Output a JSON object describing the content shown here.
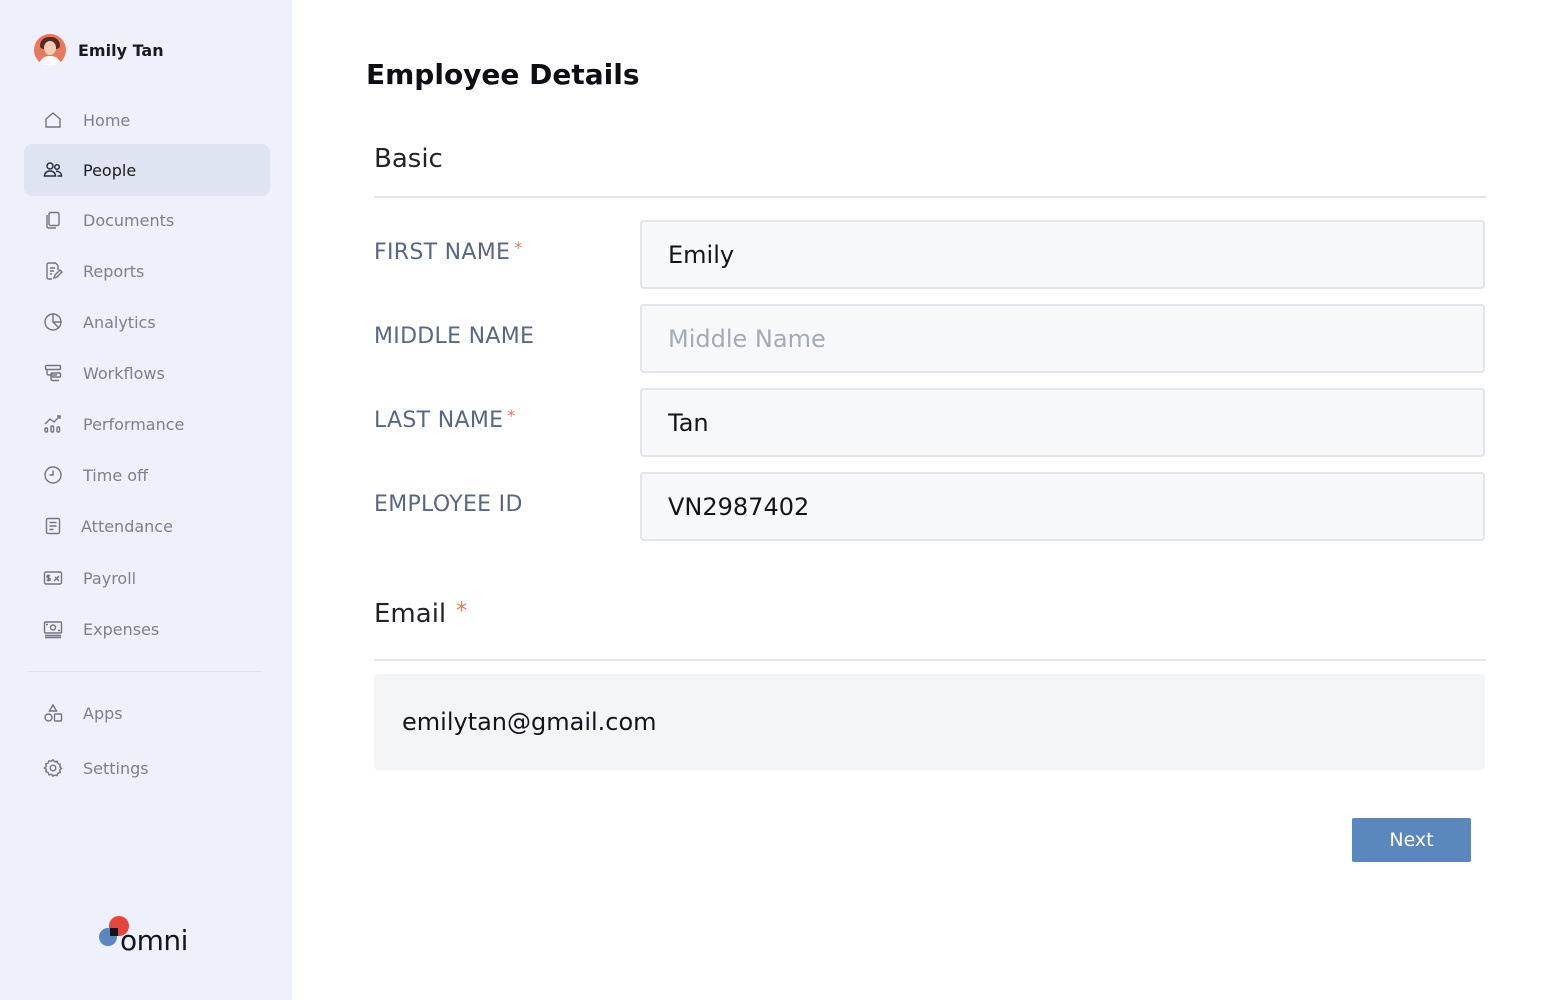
{
  "user": {
    "name": "Emily Tan"
  },
  "sidebar": {
    "items": [
      {
        "label": "Home",
        "icon": "home-icon",
        "active": false
      },
      {
        "label": "People",
        "icon": "people-icon",
        "active": true
      },
      {
        "label": "Documents",
        "icon": "documents-icon",
        "active": false
      },
      {
        "label": "Reports",
        "icon": "reports-icon",
        "active": false
      },
      {
        "label": "Analytics",
        "icon": "analytics-icon",
        "active": false
      },
      {
        "label": "Workflows",
        "icon": "workflows-icon",
        "active": false
      },
      {
        "label": "Performance",
        "icon": "performance-icon",
        "active": false
      },
      {
        "label": "Time off",
        "icon": "clock-icon",
        "active": false
      },
      {
        "label": "Attendance",
        "icon": "attendance-icon",
        "active": false
      },
      {
        "label": "Payroll",
        "icon": "payroll-icon",
        "active": false
      },
      {
        "label": "Expenses",
        "icon": "expenses-icon",
        "active": false
      }
    ],
    "bottom_items": [
      {
        "label": "Apps",
        "icon": "apps-icon"
      },
      {
        "label": "Settings",
        "icon": "gear-icon"
      }
    ],
    "logo_text": "omni"
  },
  "main": {
    "title": "Employee Details",
    "basic_section": "Basic",
    "fields": {
      "first_name": {
        "label": "FIRST NAME",
        "required_mark": "*",
        "value": "Emily",
        "placeholder": ""
      },
      "middle_name": {
        "label": "MIDDLE NAME",
        "value": "",
        "placeholder": "Middle Name"
      },
      "last_name": {
        "label": "LAST NAME",
        "required_mark": "*",
        "value": "Tan",
        "placeholder": ""
      },
      "employee_id": {
        "label": "EMPLOYEE ID",
        "value": "VN2987402",
        "placeholder": ""
      }
    },
    "email_section": {
      "title": "Email",
      "required_mark": "*",
      "value": "emilytan@gmail.com"
    },
    "next_label": "Next"
  },
  "colors": {
    "sidebar_bg": "#eef1fb",
    "active_item_bg": "#dfe4f3",
    "label_color": "#5a6782",
    "required_color": "#e07a5f",
    "button_bg": "#5b87bf"
  }
}
